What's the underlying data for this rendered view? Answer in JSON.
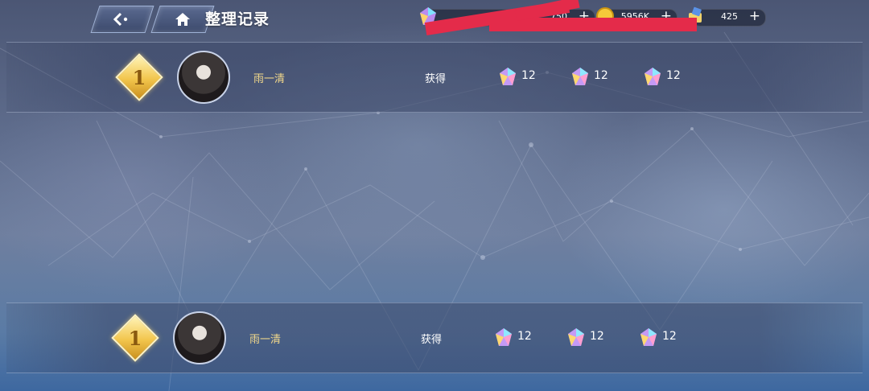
{
  "header": {
    "back_icon": "back-arrow-icon",
    "home_icon": "home-icon",
    "title": "整理记录"
  },
  "resources": {
    "gems": {
      "value": "750",
      "icon": "rainbow-gem-icon"
    },
    "coins": {
      "value": "5956K",
      "icon": "gold-coin-icon"
    },
    "tickets": {
      "value": "425",
      "icon": "ticket-icon"
    },
    "plus": "+"
  },
  "records": [
    {
      "rank": "1",
      "name": "雨一清",
      "gain_label": "获得",
      "rewards": [
        {
          "icon": "rainbow-gem-icon",
          "count": "12"
        },
        {
          "icon": "rainbow-gem-icon",
          "count": "12"
        },
        {
          "icon": "rainbow-gem-icon",
          "count": "12"
        }
      ]
    },
    {
      "rank": "1",
      "name": "雨一清",
      "gain_label": "获得",
      "rewards": [
        {
          "icon": "rainbow-gem-icon",
          "count": "12"
        },
        {
          "icon": "rainbow-gem-icon",
          "count": "12"
        },
        {
          "icon": "rainbow-gem-icon",
          "count": "12"
        }
      ]
    }
  ],
  "colors": {
    "name": "#f3d98b",
    "redaction": "#e42b4a",
    "rank_badge": "#f2c54c"
  }
}
